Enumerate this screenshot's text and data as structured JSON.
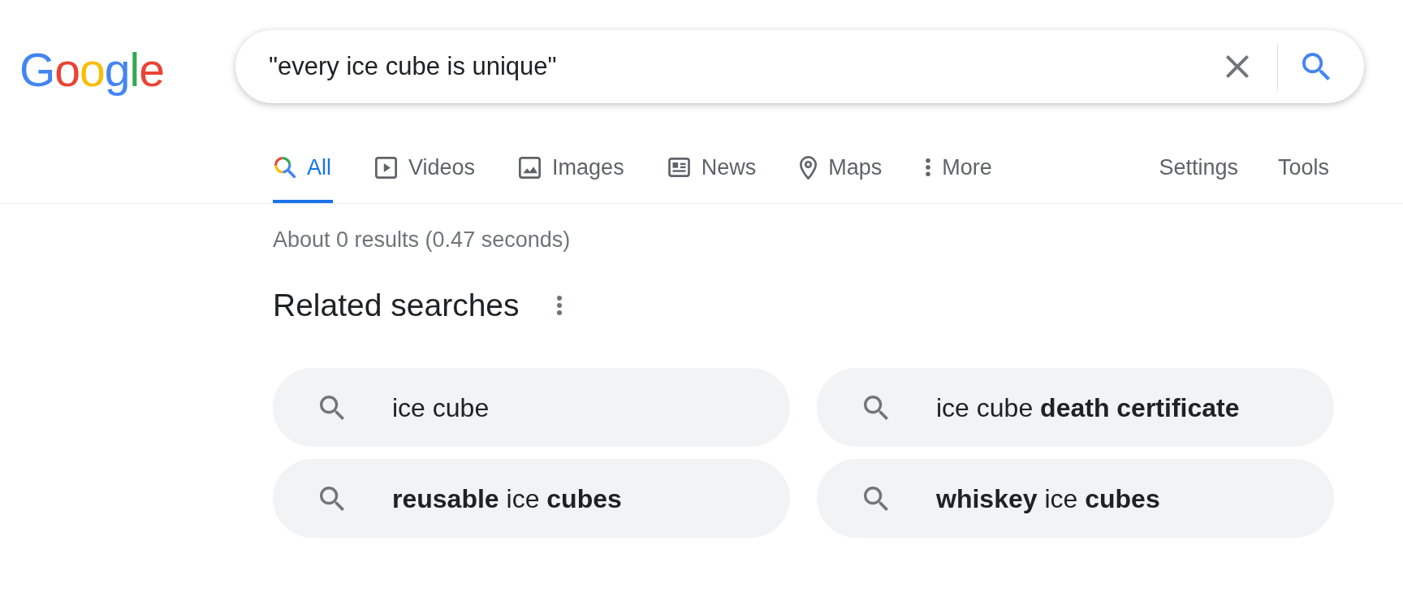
{
  "logo": {
    "text": "Google"
  },
  "search": {
    "value": "\"every ice cube is unique\""
  },
  "tabs": [
    {
      "label": "All",
      "kind": "all",
      "selected": true
    },
    {
      "label": "Videos",
      "kind": "videos",
      "selected": false
    },
    {
      "label": "Images",
      "kind": "images",
      "selected": false
    },
    {
      "label": "News",
      "kind": "news",
      "selected": false
    },
    {
      "label": "Maps",
      "kind": "maps",
      "selected": false
    },
    {
      "label": "More",
      "kind": "more",
      "selected": false
    }
  ],
  "tools": [
    {
      "label": "Settings"
    },
    {
      "label": "Tools"
    }
  ],
  "result_stats": "About 0 results (0.47 seconds)",
  "related_searches": {
    "title": "Related searches",
    "items": [
      {
        "query": "ice cube"
      },
      {
        "query": "ice cube **death certificate**"
      },
      {
        "query": "**reusable** ice **cubes**"
      },
      {
        "query": "**whiskey** ice **cubes**"
      }
    ]
  }
}
